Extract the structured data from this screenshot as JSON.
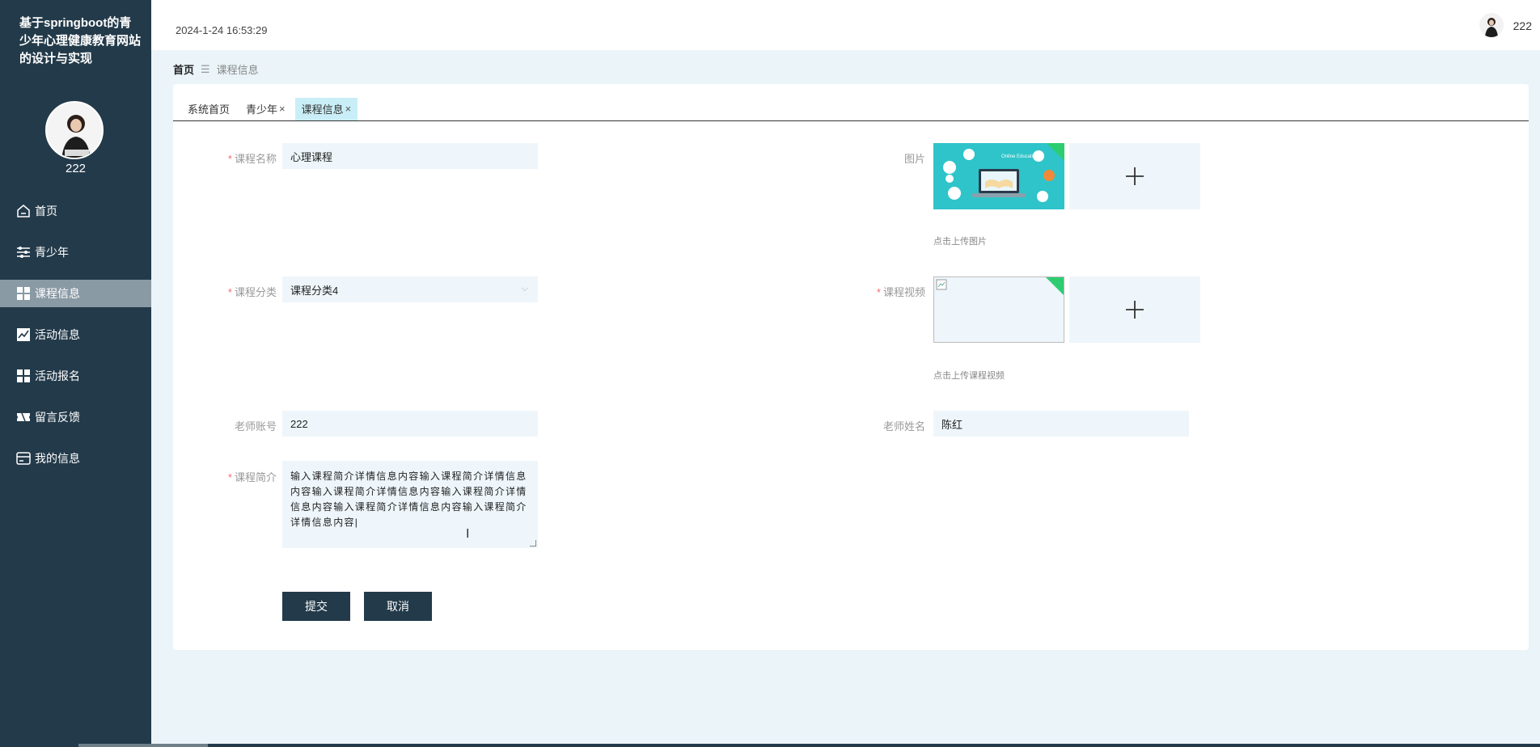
{
  "app": {
    "title": "基于springboot的青少年心理健康教育网站的设计与实现",
    "username": "222"
  },
  "header": {
    "datetime": "2024-1-24 16:53:29",
    "username": "222"
  },
  "sidebar": {
    "items": [
      {
        "label": "首页",
        "icon": "home-icon",
        "active": false
      },
      {
        "label": "青少年",
        "icon": "sliders-icon",
        "active": false
      },
      {
        "label": "课程信息",
        "icon": "grid-icon",
        "active": true
      },
      {
        "label": "活动信息",
        "icon": "chart-icon",
        "active": false
      },
      {
        "label": "活动报名",
        "icon": "grid-icon",
        "active": false
      },
      {
        "label": "留言反馈",
        "icon": "ticket-icon",
        "active": false
      },
      {
        "label": "我的信息",
        "icon": "card-icon",
        "active": false
      }
    ]
  },
  "breadcrumb": {
    "home": "首页",
    "separator": "☰",
    "current": "课程信息"
  },
  "tabs": [
    {
      "label": "系统首页",
      "closable": false,
      "active": false
    },
    {
      "label": "青少年",
      "closable": true,
      "active": false
    },
    {
      "label": "课程信息",
      "closable": true,
      "active": true
    }
  ],
  "form": {
    "course_name": {
      "label": "课程名称",
      "required": true,
      "value": "心理课程"
    },
    "image": {
      "label": "图片",
      "required": false,
      "hint": "点击上传图片"
    },
    "category": {
      "label": "课程分类",
      "required": true,
      "value": "课程分类4"
    },
    "video": {
      "label": "课程视频",
      "required": true,
      "hint": "点击上传课程视频"
    },
    "teacher_account": {
      "label": "老师账号",
      "required": false,
      "value": "222"
    },
    "teacher_name": {
      "label": "老师姓名",
      "required": false,
      "value": "陈红"
    },
    "intro": {
      "label": "课程简介",
      "required": true,
      "value": "输入课程简介详情信息内容输入课程简介详情信息内容输入课程简介详情信息内容输入课程简介详情信息内容输入课程简介详情信息内容输入课程简介详情信息内容|"
    }
  },
  "buttons": {
    "submit": "提交",
    "cancel": "取消"
  },
  "upload_thumb_text": "Online Education",
  "colors": {
    "sidebar_bg": "#233a4a",
    "active_menu": "#8a9aa5",
    "active_tab": "#c9eef7",
    "required": "#f56c6c",
    "input_bg": "#eef6fb",
    "corner_badge": "#2ecc71"
  }
}
